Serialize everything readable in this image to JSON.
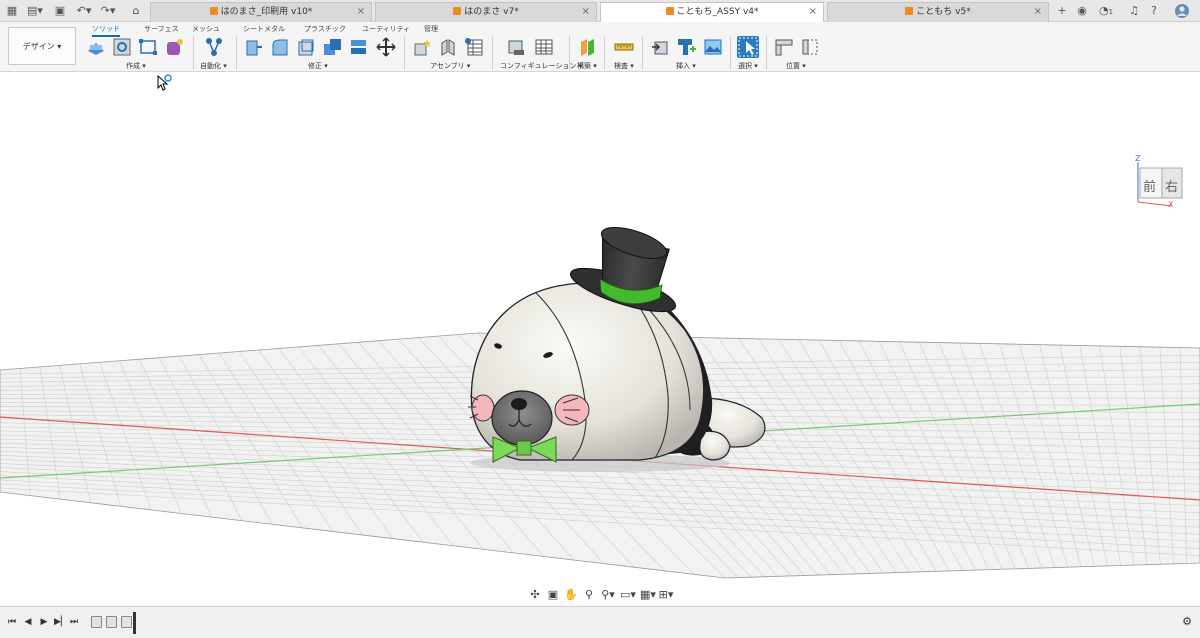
{
  "titlebar": {
    "tabs": [
      {
        "label": "はのまさ_印刷用 v10*"
      },
      {
        "label": "はのまさ v7*"
      },
      {
        "label": "こともち_ASSY v4*"
      },
      {
        "label": "こともち v5*"
      }
    ],
    "notification_count": "1"
  },
  "toolbar": {
    "workspace_label": "デザイン ▾",
    "ws_tabs": [
      "ソリッド",
      "サーフェス",
      "メッシュ",
      "シートメタル",
      "プラスチック",
      "ユーティリティ",
      "管理"
    ],
    "groups": {
      "create": "作成 ▾",
      "automate": "自動化 ▾",
      "modify": "修正 ▾",
      "assemble": "アセンブリ ▾",
      "configure": "コンフィギュレーション ▾",
      "construct": "構築 ▾",
      "inspect": "検査 ▾",
      "insert": "挿入 ▾",
      "select": "選択 ▾",
      "position": "位置 ▾"
    }
  },
  "viewcube": {
    "front": "前",
    "right": "右",
    "z_axis": "Z",
    "x_axis": "X"
  },
  "colors": {
    "accent": "#0a6fb8",
    "doc_icon": "#f08a24",
    "grid": "#cfcfcf",
    "x_axis_line": "#e05858",
    "y_axis_line": "#76c97a",
    "body_fill": "#e9e7df",
    "hat": "#3a3a3a",
    "hat_band": "#44b82e",
    "bowtie": "#7ed957",
    "cheek": "#f5b6bc"
  }
}
